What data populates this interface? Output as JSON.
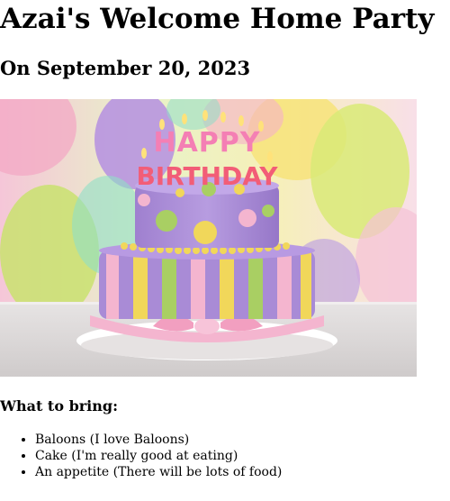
{
  "party": {
    "title": "Azai's Welcome Home Party",
    "date_heading": "On September 20, 2023"
  },
  "image": {
    "subject": "cake-image",
    "candle_text_top": "HAPPY",
    "candle_text_bottom": "BIRTHDAY"
  },
  "bring": {
    "heading": "What to bring:",
    "items": [
      "Baloons (I love Baloons)",
      "Cake (I'm really good at eating)",
      "An appetite (There will be lots of food)"
    ]
  },
  "colors": {
    "text": "#000000",
    "background": "#ffffff",
    "cake_purple": "#a98bd6",
    "cake_yellow": "#f1d75a",
    "cake_green": "#a9cf63",
    "cake_pink": "#f4b5cf"
  }
}
